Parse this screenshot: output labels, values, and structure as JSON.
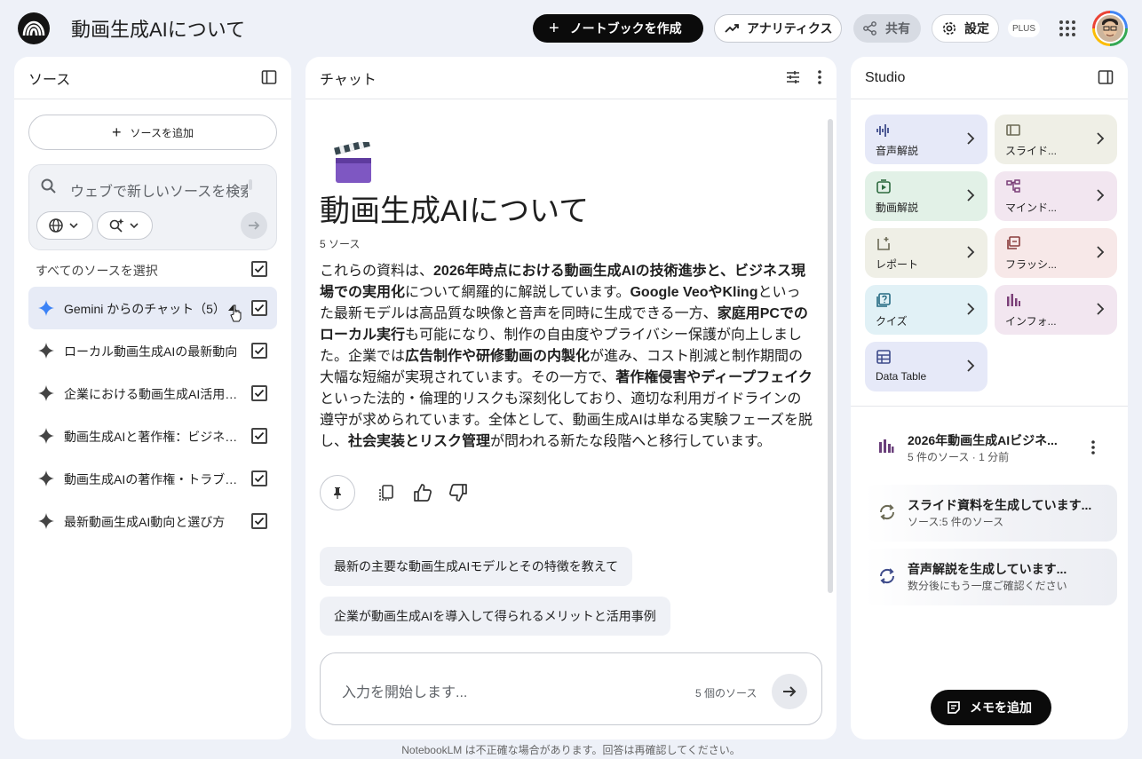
{
  "header": {
    "title": "動画生成AIについて",
    "create_notebook": "ノートブックを作成",
    "analytics": "アナリティクス",
    "share": "共有",
    "settings": "設定",
    "plan_badge": "PLUS"
  },
  "sources": {
    "panel_title": "ソース",
    "add_source": "ソースを追加",
    "search_placeholder": "ウェブで新しいソースを検索",
    "select_all": "すべてのソースを選択",
    "items": [
      {
        "label": "Gemini からのチャット（5）",
        "icon": "gemini-star-icon",
        "checked": true
      },
      {
        "label": "ローカル動画生成AIの最新動向",
        "icon": "sparkle-icon",
        "checked": true
      },
      {
        "label": "企業における動画生成AI活用…",
        "icon": "sparkle-icon",
        "checked": true
      },
      {
        "label": "動画生成AIと著作権：ビジネ…",
        "icon": "sparkle-icon",
        "checked": true
      },
      {
        "label": "動画生成AIの著作権・トラブ…",
        "icon": "sparkle-icon",
        "checked": true
      },
      {
        "label": "最新動画生成AI動向と選び方",
        "icon": "sparkle-icon",
        "checked": true
      }
    ]
  },
  "chat": {
    "panel_title": "チャット",
    "notebook_title": "動画生成AIについて",
    "source_count": "5 ソース",
    "summary": [
      {
        "t": "これらの資料は、",
        "b": false
      },
      {
        "t": "2026年時点における動画生成AIの技術進歩と、ビジネス現場での実用化",
        "b": true
      },
      {
        "t": "について網羅的に解説しています。",
        "b": false
      },
      {
        "t": "Google VeoやKling",
        "b": true
      },
      {
        "t": "といった最新モデルは高品質な映像と音声を同時に生成できる一方、",
        "b": false
      },
      {
        "t": "家庭用PCでのローカル実行",
        "b": true
      },
      {
        "t": "も可能になり、制作の自由度やプライバシー保護が向上しました。企業では",
        "b": false
      },
      {
        "t": "広告制作や研修動画の内製化",
        "b": true
      },
      {
        "t": "が進み、コスト削減と制作期間の大幅な短縮が実現されています。その一方で、",
        "b": false
      },
      {
        "t": "著作権侵害やディープフェイク",
        "b": true
      },
      {
        "t": "といった法的・倫理的リスクも深刻化しており、適切な利用ガイドラインの遵守が求められています。全体として、動画生成AIは単なる実験フェーズを脱し、",
        "b": false
      },
      {
        "t": "社会実装とリスク管理",
        "b": true
      },
      {
        "t": "が問われる新たな段階へと移行しています。",
        "b": false
      }
    ],
    "suggestions": [
      "最新の主要な動画生成AIモデルとその特徴を教えて",
      "企業が動画生成AIを導入して得られるメリットと活用事例"
    ],
    "input_placeholder": "入力を開始します...",
    "input_source_count": "5 個のソース"
  },
  "studio": {
    "panel_title": "Studio",
    "tiles": [
      {
        "label": "音声解説",
        "icon": "audio-waveform-icon",
        "bg": "#e6e9f8",
        "color": "#3d4a8a"
      },
      {
        "label": "スライド...",
        "icon": "slides-icon",
        "bg": "#efefe6",
        "color": "#6b6a55"
      },
      {
        "label": "動画解説",
        "icon": "video-icon",
        "bg": "#e2f1e7",
        "color": "#2d6a3f"
      },
      {
        "label": "マインド...",
        "icon": "mindmap-icon",
        "bg": "#f2e6f0",
        "color": "#7b3f78"
      },
      {
        "label": "レポート",
        "icon": "report-icon",
        "bg": "#efefe6",
        "color": "#6b6a55"
      },
      {
        "label": "フラッシ...",
        "icon": "flashcard-icon",
        "bg": "#f7e8e8",
        "color": "#8a3c3c"
      },
      {
        "label": "クイズ",
        "icon": "quiz-icon",
        "bg": "#e1f1f6",
        "color": "#256a82"
      },
      {
        "label": "インフォ...",
        "icon": "infographic-icon",
        "bg": "#f2e6f0",
        "color": "#7b3f78"
      },
      {
        "label": "Data Table",
        "icon": "data-table-icon",
        "bg": "#e6e9f8",
        "color": "#3d4a8a"
      }
    ],
    "notes": [
      {
        "title": "2026年動画生成AIビジネ...",
        "sub": "5 件のソース · 1 分前",
        "icon": "infographic-icon"
      },
      {
        "title": "スライド資料を生成しています...",
        "sub": "ソース:5 件のソース",
        "icon": "sync-icon"
      },
      {
        "title": "音声解説を生成しています...",
        "sub": "数分後にもう一度ご確認ください",
        "icon": "sync-icon"
      }
    ],
    "add_memo": "メモを追加"
  },
  "footer": "NotebookLM は不正確な場合があります。回答は再確認してください。"
}
